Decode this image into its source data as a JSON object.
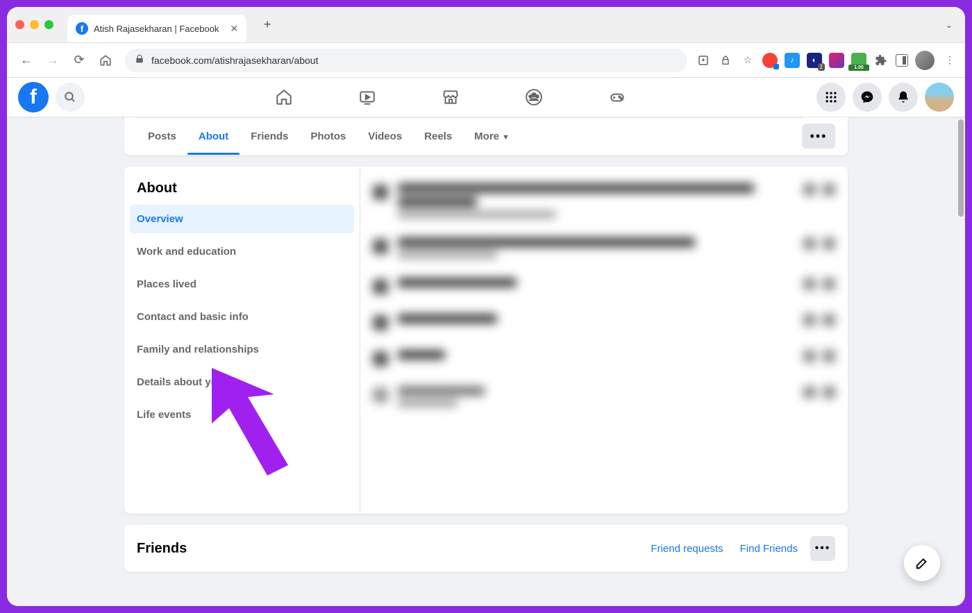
{
  "browser": {
    "tab_title": "Atish Rajasekharan | Facebook",
    "url": "facebook.com/atishrajasekharan/about",
    "ext_badge_2": "2",
    "ext_badge_100": "1.00"
  },
  "profile_tabs": {
    "posts": "Posts",
    "about": "About",
    "friends": "Friends",
    "photos": "Photos",
    "videos": "Videos",
    "reels": "Reels",
    "more": "More"
  },
  "about": {
    "heading": "About",
    "nav": {
      "overview": "Overview",
      "work": "Work and education",
      "places": "Places lived",
      "contact": "Contact and basic info",
      "family": "Family and relationships",
      "details": "Details about you",
      "life": "Life events"
    }
  },
  "friends": {
    "heading": "Friends",
    "requests": "Friend requests",
    "find": "Find Friends"
  }
}
